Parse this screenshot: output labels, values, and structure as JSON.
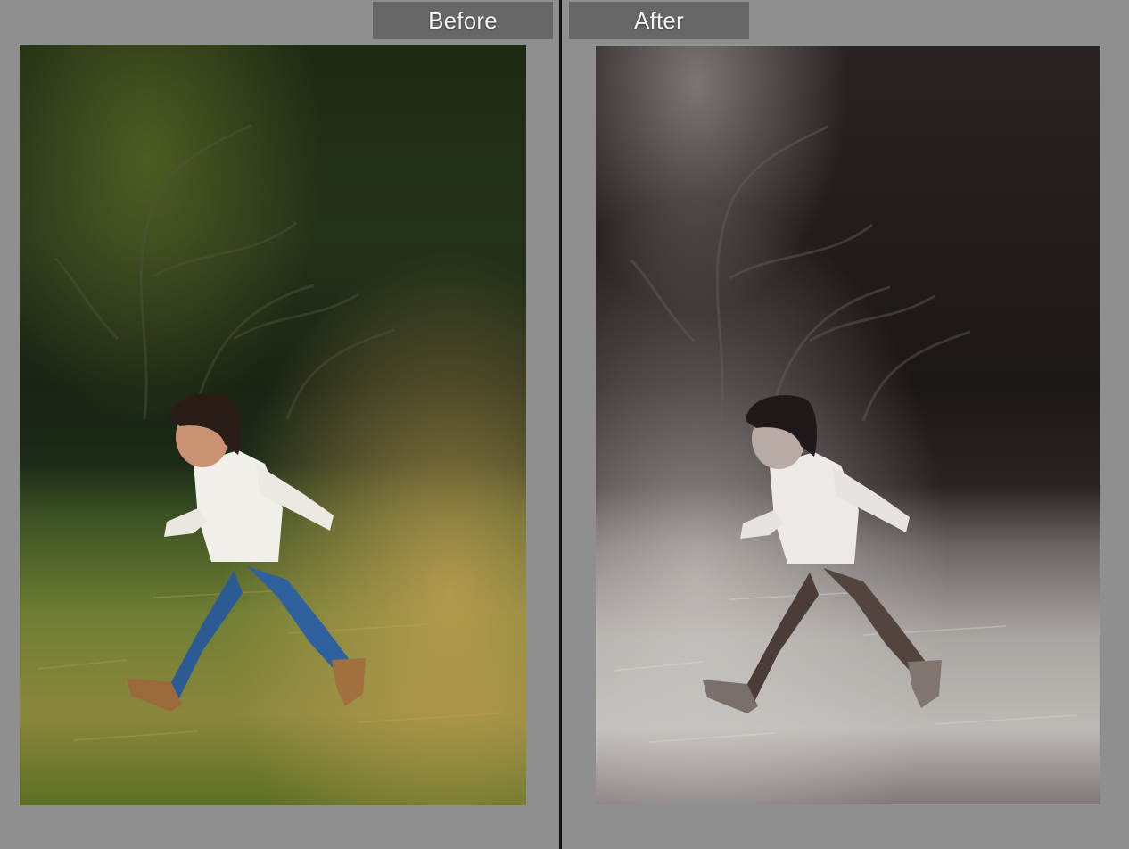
{
  "compare_view": {
    "before_label": "Before",
    "after_label": "After"
  },
  "photos": {
    "before": {
      "icon": "photo-color",
      "colors": {
        "sky_dark": "#1b2414",
        "foliage": "#2c3a1c",
        "grass": "#7c8a3a",
        "grass_warm": "#b79544",
        "shirt": "#f1efea",
        "jeans": "#2b5a95",
        "boots": "#9b6a3c",
        "hair": "#2a1d16",
        "skin": "#c99273"
      }
    },
    "after": {
      "icon": "photo-monochrome",
      "colors": {
        "sky_dark": "#1c1818",
        "foliage": "#3a3232",
        "grass": "#8c8886",
        "grass_warm": "#c9c5c2",
        "shirt": "#ece9e6",
        "jeans": "#4b3c37",
        "boots": "#7a706b",
        "hair": "#1f1a19",
        "skin": "#b8aaa4"
      }
    }
  },
  "accent": {
    "background": "#8f8f8f",
    "tab_background": "#676767",
    "tab_text": "#f2f2f2",
    "divider": "#111111"
  }
}
